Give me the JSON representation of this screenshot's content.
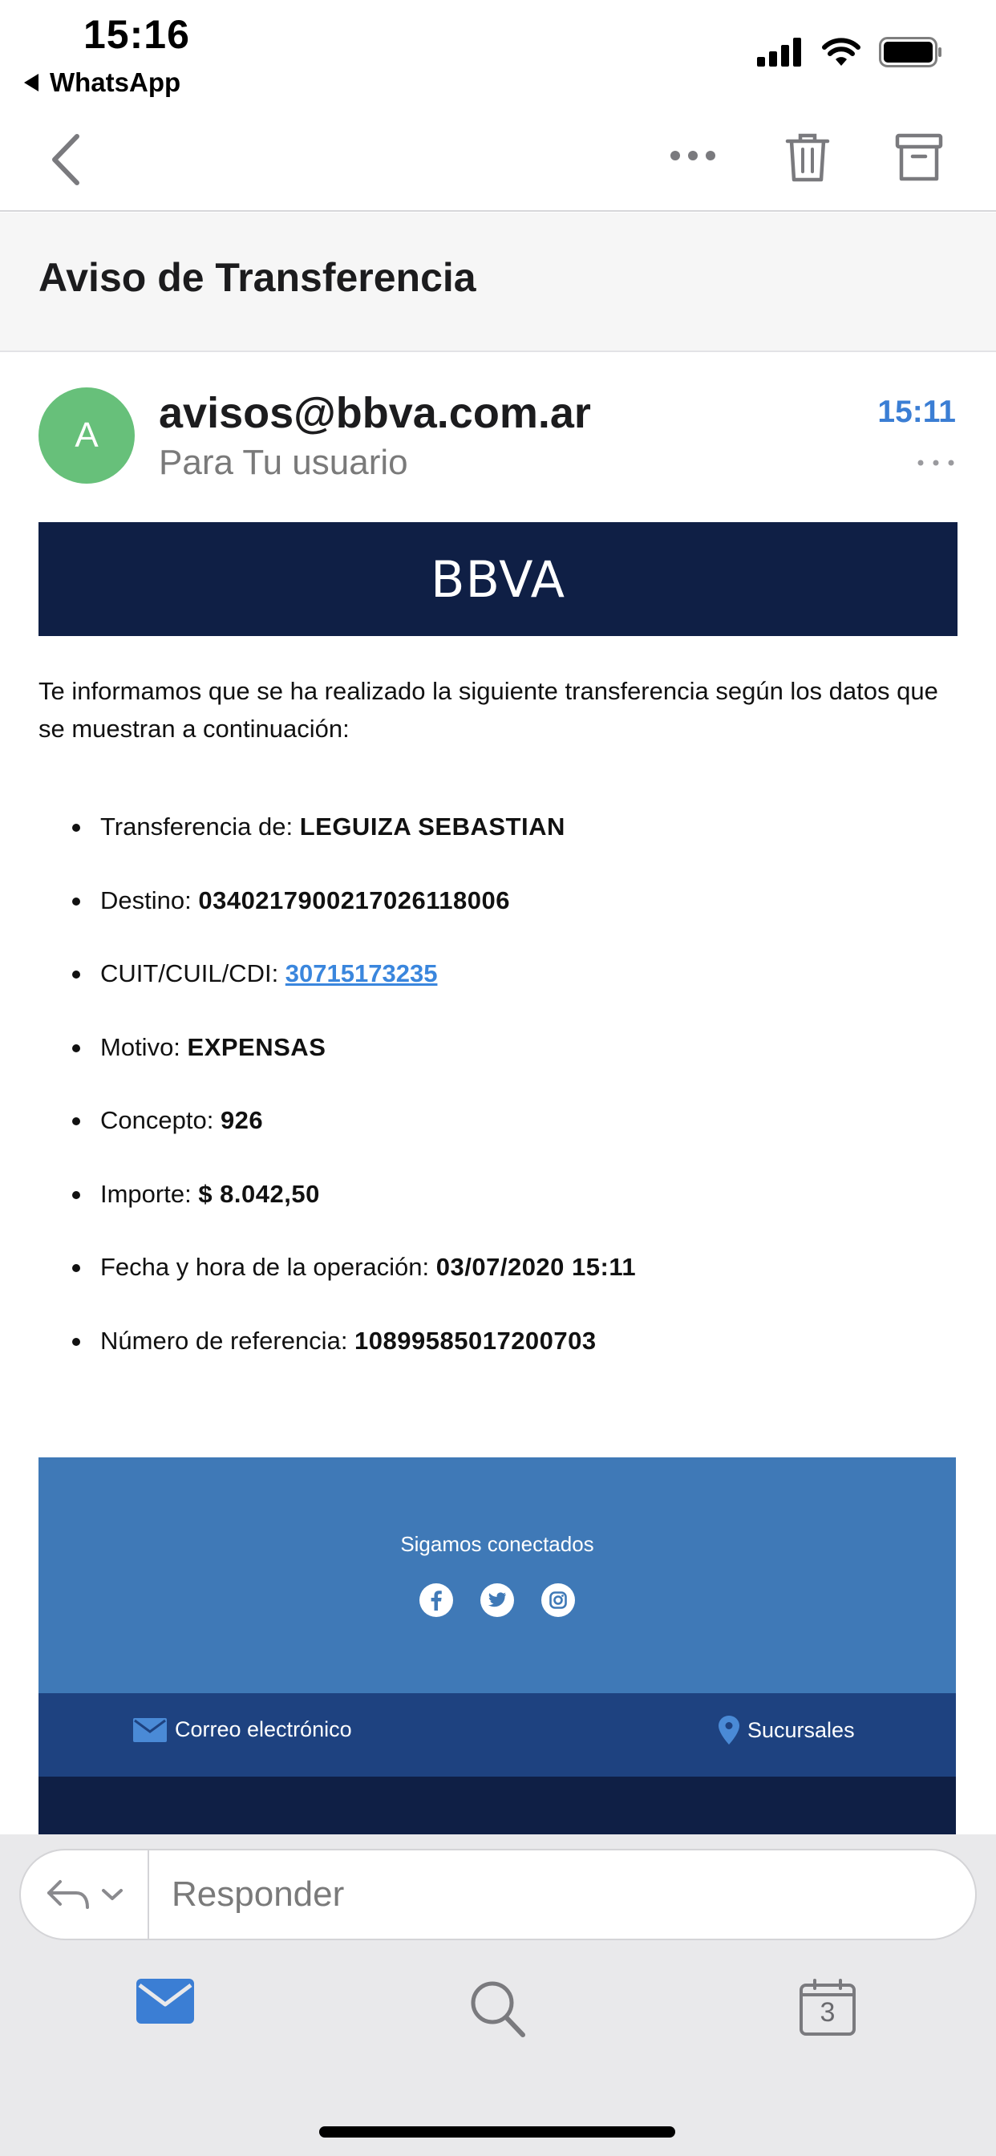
{
  "status_bar": {
    "time": "15:16",
    "back_app": "WhatsApp"
  },
  "toolbar": {
    "icons": [
      "back-chevron",
      "more-options",
      "trash",
      "archive"
    ]
  },
  "email": {
    "subject": "Aviso de Transferencia",
    "avatar_initial": "A",
    "sender": "avisos@bbva.com.ar",
    "recipient": "Para Tu usuario",
    "time": "15:11",
    "banner_logo": "BBVA",
    "intro": "Te informamos que se ha realizado la siguiente transferencia según los datos que se muestran a continuación:",
    "details": [
      {
        "label": "Transferencia de: ",
        "value": "LEGUIZA SEBASTIAN"
      },
      {
        "label": "Destino: ",
        "value": "0340217900217026118006"
      },
      {
        "label": "CUIT/CUIL/CDI: ",
        "value": "30715173235",
        "link": true
      },
      {
        "label": "Motivo: ",
        "value": "EXPENSAS"
      },
      {
        "label": "Concepto: ",
        "value": "926"
      },
      {
        "label": "Importe: ",
        "value": "$ 8.042,50"
      },
      {
        "label": "Fecha y hora de la operación: ",
        "value": "03/07/2020 15:11"
      },
      {
        "label": "Número de referencia: ",
        "value": "10899585017200703"
      }
    ],
    "footer": {
      "follow_text": "Sigamos conectados",
      "social": [
        "facebook",
        "twitter",
        "instagram"
      ],
      "mail_link": "Correo electrónico",
      "branches_link": "Sucursales"
    }
  },
  "reply": {
    "placeholder": "Responder"
  },
  "tabbar": {
    "calendar_day": "3"
  },
  "colors": {
    "accent": "#3b7ed4",
    "avatar": "#67c07a",
    "bbva_navy": "#0f1f45",
    "bbva_blue": "#3f79b7",
    "bbva_mid": "#1e4280"
  }
}
